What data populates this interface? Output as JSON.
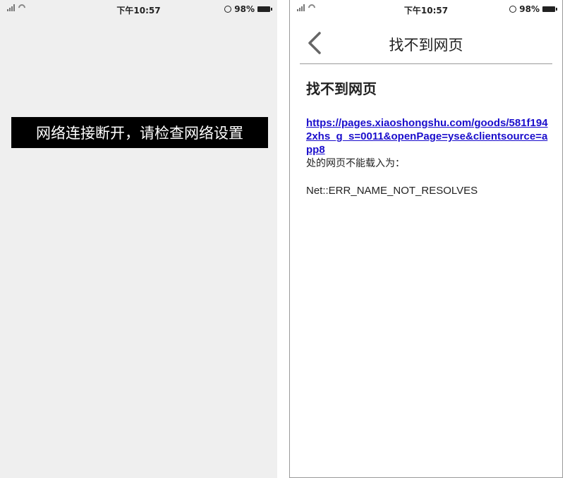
{
  "status_bar": {
    "time": "下午10:57",
    "battery_percent": "98%",
    "signal_label": "3il",
    "icons": [
      "signal-icon",
      "wifi-icon",
      "alarm-icon",
      "battery-icon"
    ]
  },
  "left_screen": {
    "toast_message": "网络连接断开，请检查网络设置"
  },
  "right_screen": {
    "nav_title": "找不到网页",
    "error_title": "找不到网页",
    "url": "https://pages.xiaoshongshu.com/goods/581f1942xhs_g_s=0011&openPage=yse&clientsource=app8",
    "description": "处的网页不能载入为：",
    "error_code": "Net::ERR_NAME_NOT_RESOLVES"
  },
  "colors": {
    "link": "#1a0dcc",
    "left_background": "#efefef",
    "toast_background": "#000000"
  }
}
